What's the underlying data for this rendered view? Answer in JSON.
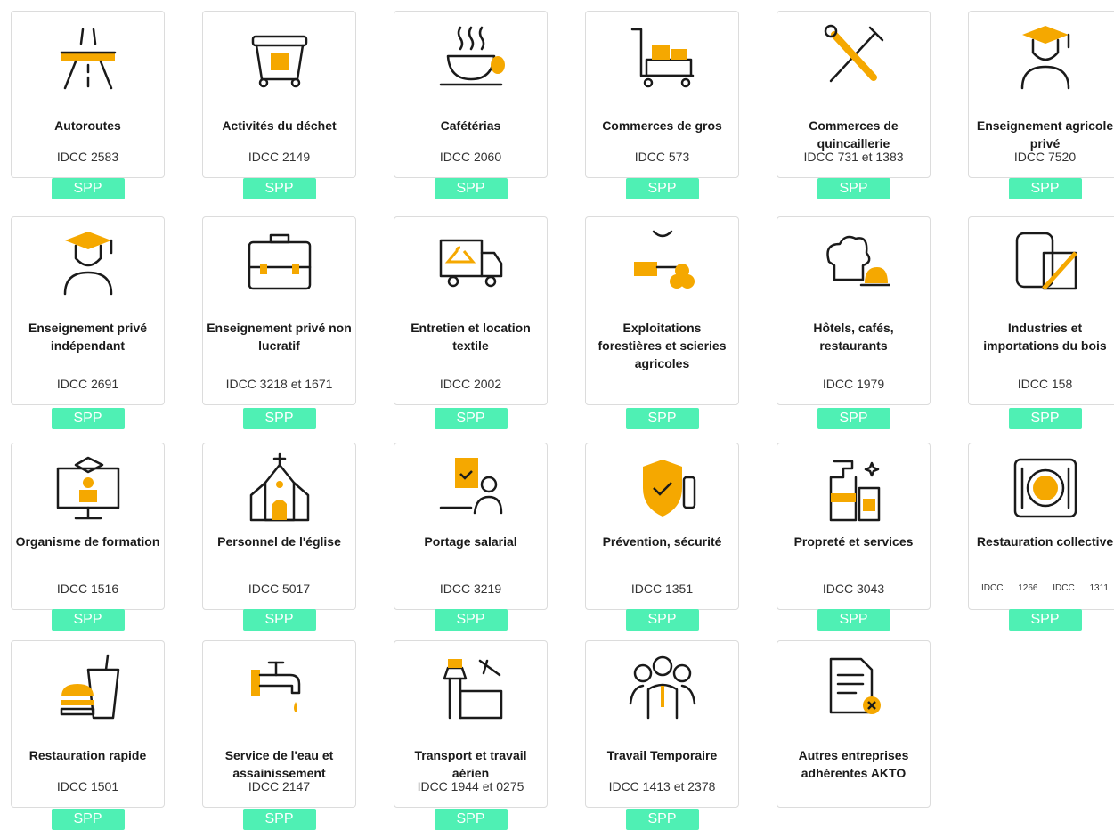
{
  "button_label": "SPP",
  "colors": {
    "accent": "#f5a800",
    "button": "#4ff0b4",
    "line": "#1a1a1a"
  },
  "cards": [
    {
      "title": "Autoroutes",
      "idcc": "IDCC 2583",
      "icon": "highway-icon"
    },
    {
      "title": "Activités du déchet",
      "idcc": "IDCC 2149",
      "icon": "recycling-bin-icon"
    },
    {
      "title": "Cafétérias",
      "idcc": "IDCC 2060",
      "icon": "coffee-cup-icon"
    },
    {
      "title": "Commerces de gros",
      "idcc": "IDCC 573",
      "icon": "cart-icon"
    },
    {
      "title": "Commerces de quincaillerie",
      "idcc": "IDCC 731 et 1383",
      "icon": "tools-icon"
    },
    {
      "title": "Enseignement agricole privé",
      "idcc": "IDCC 7520",
      "icon": "graduate-icon"
    },
    {
      "title": "Enseignement privé indépendant",
      "idcc": "IDCC 2691",
      "icon": "graduate-icon"
    },
    {
      "title": "Enseignement privé non lucratif",
      "idcc": "IDCC 3218 et 1671",
      "icon": "briefcase-icon"
    },
    {
      "title": "Entretien et location textile",
      "idcc": "IDCC 2002",
      "icon": "truck-icon"
    },
    {
      "title": "Exploitations forestières et scieries agricoles",
      "idcc": "",
      "icon": "chainsaw-icon"
    },
    {
      "title": "Hôtels, cafés, restaurants",
      "idcc": "IDCC 1979",
      "icon": "chef-hat-icon"
    },
    {
      "title": "Industries et importations du bois",
      "idcc": "IDCC 158",
      "icon": "wood-crate-icon"
    },
    {
      "title": "Organisme de formation",
      "idcc": "IDCC 1516",
      "icon": "online-training-icon"
    },
    {
      "title": "Personnel de l'église",
      "idcc": "IDCC 5017",
      "icon": "church-icon"
    },
    {
      "title": "Portage salarial",
      "idcc": "IDCC 3219",
      "icon": "freelancer-icon"
    },
    {
      "title": "Prévention, sécurité",
      "idcc": "IDCC 1351",
      "icon": "security-shield-icon"
    },
    {
      "title": "Propreté et services",
      "idcc": "IDCC 3043",
      "icon": "cleaning-products-icon"
    },
    {
      "title": "Restauration collective",
      "idcc": "IDCC 1266 IDCC 1311",
      "icon": "plate-icon"
    },
    {
      "title": "Restauration rapide",
      "idcc": "IDCC 1501",
      "icon": "fast-food-icon"
    },
    {
      "title": "Service de l'eau et assainissement",
      "idcc": "IDCC 2147",
      "icon": "water-tap-icon"
    },
    {
      "title": "Transport et travail aérien",
      "idcc": "IDCC 1944 et 0275",
      "icon": "airport-icon"
    },
    {
      "title": "Travail Temporaire",
      "idcc": "IDCC 1413 et 2378",
      "icon": "team-icon"
    },
    {
      "title": "Autres entreprises adhérentes AKTO",
      "idcc": "",
      "icon": "document-icon"
    }
  ]
}
